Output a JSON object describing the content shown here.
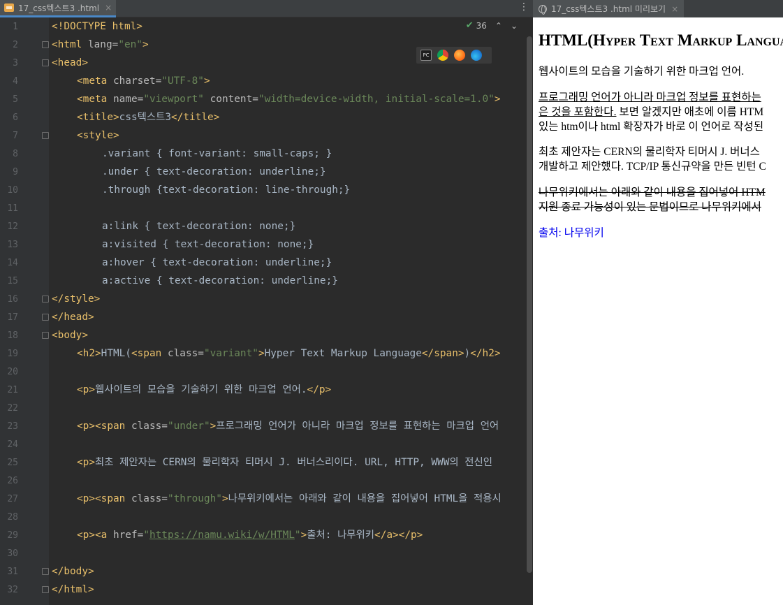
{
  "editor": {
    "tab_label": "17_css텍스트3 .html",
    "tab_close": "×",
    "menu_glyph": "⋮",
    "inspection_count": "36",
    "inspection_check": "✔",
    "browser_icons": [
      "pycharm-icon",
      "chrome-icon",
      "firefox-icon",
      "edge-icon"
    ],
    "line_numbers": [
      "1",
      "2",
      "3",
      "4",
      "5",
      "6",
      "7",
      "8",
      "9",
      "10",
      "11",
      "12",
      "13",
      "14",
      "15",
      "16",
      "17",
      "18",
      "19",
      "20",
      "21",
      "22",
      "23",
      "24",
      "25",
      "26",
      "27",
      "28",
      "29",
      "30",
      "31",
      "32"
    ],
    "code": {
      "l1": "<!DOCTYPE html>",
      "l2a": "<html ",
      "l2b": "lang=",
      "l2c": "\"en\"",
      "l2d": ">",
      "l3": "<head>",
      "l4a": "<meta ",
      "l4b": "charset=",
      "l4c": "\"UTF-8\"",
      "l4d": ">",
      "l5a": "<meta ",
      "l5b": "name=",
      "l5c": "\"viewport\"",
      "l5d": " content=",
      "l5e": "\"width=device-width, initial-scale=1.0\"",
      "l5f": ">",
      "l6a": "<title>",
      "l6b": "css텍스트3",
      "l6c": "</title>",
      "l7": "<style>",
      "l8": ".variant { font-variant: small-caps; }",
      "l9": ".under { text-decoration: underline;}",
      "l10": ".through {text-decoration: line-through;}",
      "l12": "a:link { text-decoration: none;}",
      "l13": "a:visited { text-decoration: none;}",
      "l14": "a:hover { text-decoration: underline;}",
      "l15": "a:active { text-decoration: underline;}",
      "l16": "</style>",
      "l17": "</head>",
      "l18": "<body>",
      "l19a": "<h2>",
      "l19b": "HTML(",
      "l19c": "<span ",
      "l19d": "class=",
      "l19e": "\"variant\"",
      "l19f": ">",
      "l19g": "Hyper Text Markup Language",
      "l19h": "</span>",
      "l19i": ")",
      "l19j": "</h2>",
      "l21a": "<p>",
      "l21b": "웹사이트의 모습을 기술하기 위한 마크업 언어.",
      "l21c": "</p>",
      "l23a": "<p><span ",
      "l23b": "class=",
      "l23c": "\"under\"",
      "l23d": ">",
      "l23e": "프로그래밍 언어가 아니라 마크업 정보를 표현하는 마크업 언어",
      "l25a": "<p>",
      "l25b": "최초 제안자는 CERN의 물리학자 티머시 J. 버너스리이다. URL, HTTP, WWW의 전신인",
      "l27a": "<p><span ",
      "l27b": "class=",
      "l27c": "\"through\"",
      "l27d": ">",
      "l27e": "나무위키에서는 아래와 같이 내용을 집어넣어 HTML을 적용시",
      "l29a": "<p><a ",
      "l29b": "href=",
      "l29c": "\"",
      "l29d": "https://namu.wiki/w/HTML",
      "l29e": "\"",
      "l29f": ">",
      "l29g": "출처: 나무위키",
      "l29h": "</a></p>",
      "l31": "</body>",
      "l32": "</html>"
    }
  },
  "preview": {
    "tab_label": "17_css텍스트3 .html 미리보기",
    "tab_close": "×",
    "h2_prefix": "HTML(",
    "h2_variant": "Hyper Text Markup Language",
    "p1": "웹사이트의 모습을 기술하기 위한 마크업 언어.",
    "p2_line1_under": "프로그래밍 언어가 아니라 마크업 정보를 표현하는",
    "p2_line2_under": "은 것을 포함한다.",
    "p2_line2_rest": " 보면 알겠지만 애초에 이름 HTM",
    "p2_line3": "있는 htm이나 html 확장자가 바로 이 언어로 작성된",
    "p3_line1": "최초 제안자는 CERN의 물리학자 티머시 J. 버너스",
    "p3_line2": "개발하고 제안했다. TCP/IP 통신규약을 만든 빈턴 C",
    "p4_line1": "나무위키에서는 아래와 같이 내용을 집어넣어 HTM",
    "p4_line2": "지원 종료 가능성이 있는 문법이므로 나무위키에서",
    "link": "출처: 나무위키"
  }
}
